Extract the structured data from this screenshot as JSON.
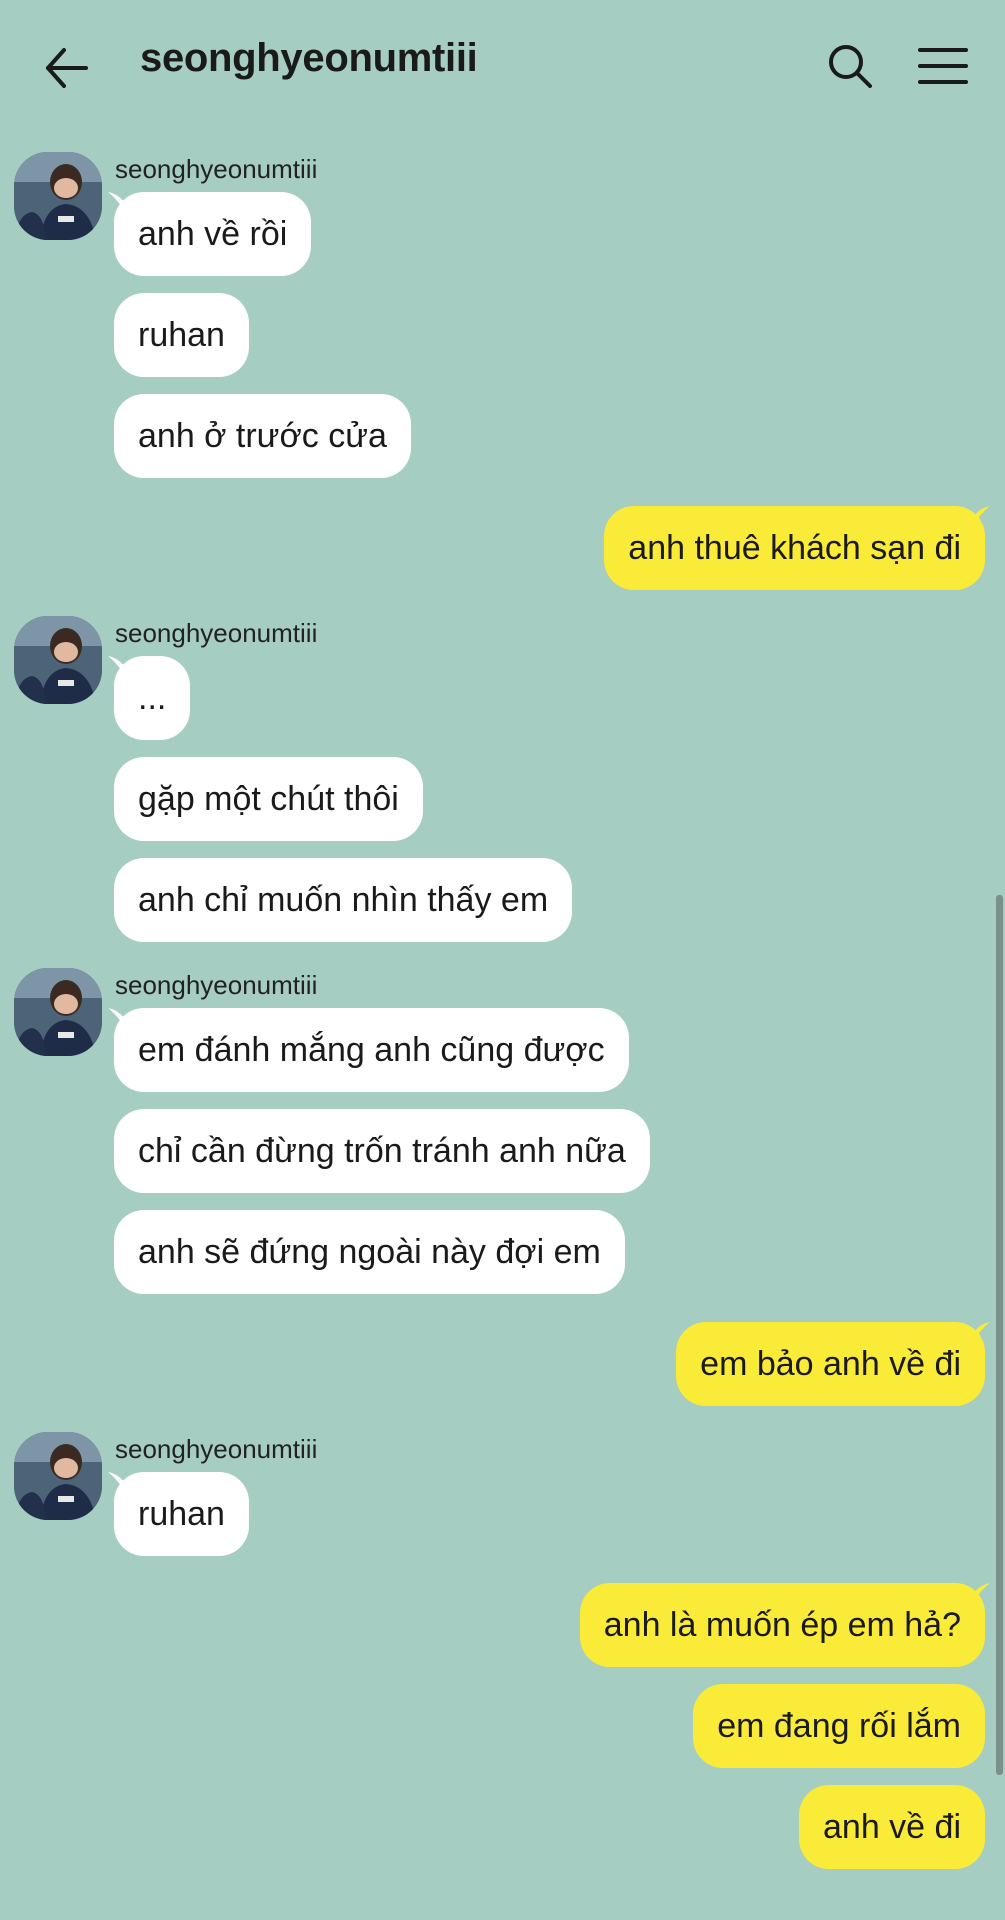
{
  "header": {
    "title": "seonghyeonumtiii",
    "back_icon": "arrow-left-icon",
    "search_icon": "search-icon",
    "menu_icon": "menu-icon"
  },
  "colors": {
    "background": "#a6cdc1",
    "incoming_bubble": "#ffffff",
    "outgoing_bubble": "#fbeb39"
  },
  "groups": [
    {
      "sender": "seonghyeonumtiii",
      "messages": [
        "anh về rồi",
        "ruhan",
        "anh ở trước cửa"
      ]
    },
    {
      "outgoing": [
        "anh thuê khách sạn đi"
      ]
    },
    {
      "sender": "seonghyeonumtiii",
      "messages": [
        "...",
        "gặp một chút thôi",
        "anh chỉ muốn nhìn thấy em"
      ]
    },
    {
      "sender": "seonghyeonumtiii",
      "messages": [
        "em đánh mắng anh cũng được",
        "chỉ cần đừng trốn tránh anh nữa",
        "anh sẽ đứng ngoài này đợi em"
      ]
    },
    {
      "outgoing": [
        "em bảo anh về đi"
      ]
    },
    {
      "sender": "seonghyeonumtiii",
      "messages": [
        "ruhan"
      ]
    },
    {
      "outgoing": [
        "anh là muốn ép em hả?",
        "em đang rối lắm",
        "anh về đi"
      ]
    }
  ]
}
